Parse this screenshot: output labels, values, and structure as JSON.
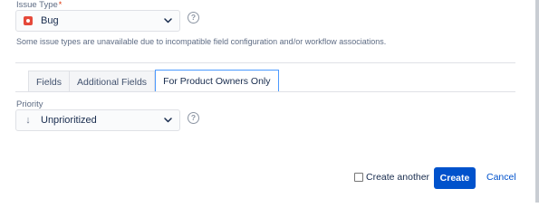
{
  "issue_type": {
    "label": "Issue Type",
    "required_mark": "*",
    "selected_value": "Bug",
    "note": "Some issue types are unavailable due to incompatible field configuration and/or workflow associations."
  },
  "tabs": [
    {
      "label": "Fields",
      "active": false
    },
    {
      "label": "Additional Fields",
      "active": false
    },
    {
      "label": "For Product Owners Only",
      "active": true
    }
  ],
  "priority": {
    "label": "Priority",
    "selected_value": "Unprioritized"
  },
  "footer": {
    "create_another_label": "Create another",
    "create_another_checked": false,
    "create_label": "Create",
    "cancel_label": "Cancel"
  },
  "icons": {
    "help": "?",
    "priority_arrow": "↓",
    "chevron": "chevron-down"
  },
  "colors": {
    "primary": "#0052cc",
    "bug": "#e5493a",
    "active_tab_border": "#4c9aff",
    "required": "#de350b"
  }
}
